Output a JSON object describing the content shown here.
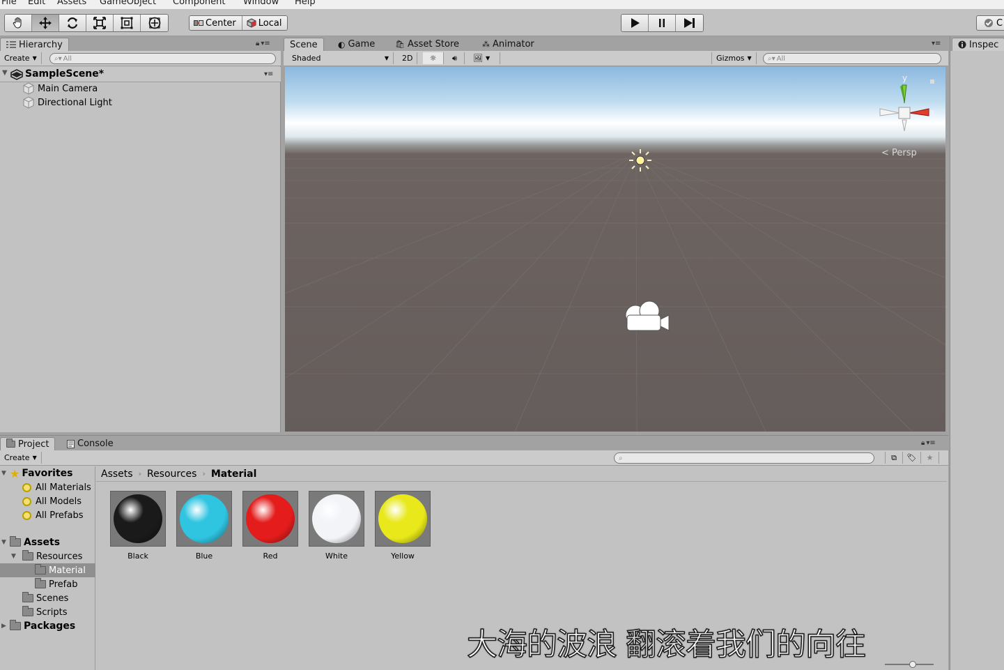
{
  "menubar": {
    "items": [
      "File",
      "Edit",
      "Assets",
      "GameObject",
      "Component",
      "Window",
      "Help"
    ]
  },
  "toolbar": {
    "tools": [
      {
        "name": "hand-tool",
        "icon": "hand-icon"
      },
      {
        "name": "move-tool",
        "icon": "move-arrows-icon"
      },
      {
        "name": "rotate-tool",
        "icon": "rotate-icon"
      },
      {
        "name": "scale-tool",
        "icon": "scale-icon"
      },
      {
        "name": "rect-tool",
        "icon": "rect-transform-icon"
      },
      {
        "name": "transform-tool",
        "icon": "transform-icon"
      }
    ],
    "active_tool": "move-tool",
    "pivot_center_label": "Center",
    "pivot_local_label": "Local",
    "play_icon": "play-icon",
    "pause_icon": "pause-icon",
    "step_icon": "step-icon",
    "collab_label": "C"
  },
  "hierarchy": {
    "tab_label": "Hierarchy",
    "create_label": "Create",
    "search_placeholder": "All",
    "scene_name": "SampleScene*",
    "items": [
      {
        "label": "Main Camera"
      },
      {
        "label": "Directional Light"
      }
    ]
  },
  "scene_tabs": {
    "tabs": [
      {
        "label": "Scene",
        "icon": "scene-icon",
        "active": true
      },
      {
        "label": "Game",
        "icon": "game-icon",
        "active": false
      },
      {
        "label": "Asset Store",
        "icon": "asset-store-icon",
        "active": false
      },
      {
        "label": "Animator",
        "icon": "animator-icon",
        "active": false
      }
    ],
    "shading_mode": "Shaded",
    "mode_2d_label": "2D",
    "gizmos_label": "Gizmos",
    "search_placeholder": "All",
    "persp_label": "Persp",
    "gizmo_axis_y": "y",
    "gizmo_axis_x": "x"
  },
  "inspector": {
    "tab_label": "Inspec"
  },
  "project": {
    "tabs": [
      {
        "label": "Project",
        "active": true
      },
      {
        "label": "Console",
        "active": false
      }
    ],
    "create_label": "Create",
    "tree": [
      {
        "label": "Favorites",
        "kind": "favorites",
        "bold": true
      },
      {
        "label": "All Materials",
        "kind": "search"
      },
      {
        "label": "All Models",
        "kind": "search"
      },
      {
        "label": "All Prefabs",
        "kind": "search"
      },
      {
        "label": "Assets",
        "kind": "folder",
        "bold": true
      },
      {
        "label": "Resources",
        "kind": "folder"
      },
      {
        "label": "Material",
        "kind": "folder",
        "selected": true
      },
      {
        "label": "Prefab",
        "kind": "folder"
      },
      {
        "label": "Scenes",
        "kind": "folder"
      },
      {
        "label": "Scripts",
        "kind": "folder"
      },
      {
        "label": "Packages",
        "kind": "folder",
        "bold": true
      }
    ],
    "breadcrumb": [
      "Assets",
      "Resources",
      "Material"
    ],
    "assets": [
      {
        "label": "Black",
        "color": "#1a1a1a"
      },
      {
        "label": "Blue",
        "color": "#2fc4e0"
      },
      {
        "label": "Red",
        "color": "#e41c1c"
      },
      {
        "label": "White",
        "color": "#f2f4f8"
      },
      {
        "label": "Yellow",
        "color": "#e8e81a"
      }
    ]
  },
  "overlay": {
    "subtitle": "大海的波浪 翻滚着我们的向往"
  }
}
